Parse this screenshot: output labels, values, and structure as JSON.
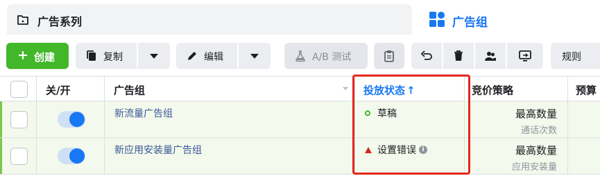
{
  "tabs": {
    "campaign_label": "广告系列",
    "adset_label": "广告组"
  },
  "toolbar": {
    "create_label": "创建",
    "create_plus": "+",
    "duplicate_label": "复制",
    "edit_label": "编辑",
    "ab_test_label": "A/B 测试",
    "rules_label": "规则"
  },
  "table": {
    "headers": {
      "toggle": "关/开",
      "adset": "广告组",
      "status": "投放状态",
      "status_sort": "↑",
      "bid": "竞价策略",
      "budget": "预算"
    },
    "rows": [
      {
        "name": "新流量广告组",
        "status": "草稿",
        "status_icon": "draft-circle-icon",
        "bid_main": "最高数量",
        "bid_sub": "通话次数",
        "toggle_on": true
      },
      {
        "name": "新应用安装量广告组",
        "status": "设置错误",
        "status_icon": "error-triangle-icon",
        "bid_main": "最高数量",
        "bid_sub": "应用安装量",
        "toggle_on": true
      }
    ]
  },
  "colors": {
    "accent": "#1877f2",
    "create_green": "#42b72a",
    "row_bg": "#f3f9ec",
    "highlight_red": "#e3261c"
  }
}
